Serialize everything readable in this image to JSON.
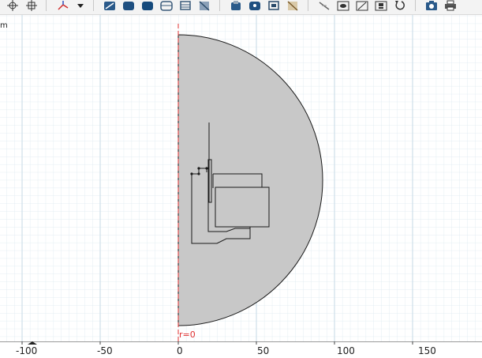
{
  "toolbar": {
    "tools": [
      {
        "name": "zoom-box-icon"
      },
      {
        "name": "zoom-extents-icon"
      },
      {
        "name": "axis-orientation-icon"
      },
      {
        "name": "dropdown-arrow-icon"
      },
      {
        "name": "select-all-icon"
      },
      {
        "name": "select-domain-icon"
      },
      {
        "name": "select-boundary-icon"
      },
      {
        "name": "select-edge-icon"
      },
      {
        "name": "select-point-icon"
      },
      {
        "name": "clear-selection-icon"
      },
      {
        "name": "build-selected-icon"
      },
      {
        "name": "build-all-icon"
      },
      {
        "name": "hide-icon"
      },
      {
        "name": "show-icon"
      },
      {
        "name": "view-icon"
      },
      {
        "name": "undo-view-icon"
      },
      {
        "name": "image-snapshot-icon"
      },
      {
        "name": "print-icon"
      }
    ]
  },
  "canvas": {
    "unit_label": "m",
    "axis_label": "r=0",
    "axis_color": "#e03030",
    "domain_fill": "#c8c8c8",
    "grid_color": "#cfe3ee",
    "ruler_ticks": [
      "-100",
      "-50",
      "0",
      "50",
      "100",
      "150"
    ]
  }
}
